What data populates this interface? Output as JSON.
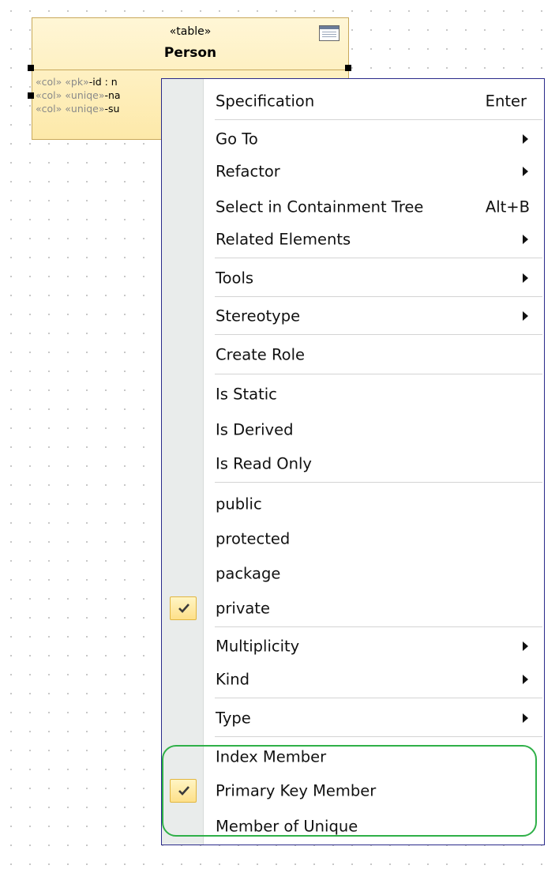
{
  "table": {
    "stereotype": "«table»",
    "name": "Person",
    "rows": [
      {
        "stereo": "«col» «pk»",
        "text": "-id : n"
      },
      {
        "stereo": "«col» «uniqe»",
        "text": "-na"
      },
      {
        "stereo": "«col» «uniqe»",
        "text": "-su"
      }
    ]
  },
  "menu": {
    "items": {
      "specification": {
        "label": "Specification",
        "shortcut": "Enter"
      },
      "go_to": {
        "label": "Go To"
      },
      "refactor": {
        "label": "Refactor"
      },
      "select_tree": {
        "label": "Select in Containment Tree",
        "shortcut": "Alt+B"
      },
      "related": {
        "label": "Related Elements"
      },
      "tools": {
        "label": "Tools"
      },
      "stereotype": {
        "label": "Stereotype"
      },
      "create_role": {
        "label": "Create Role"
      },
      "is_static": {
        "label": "Is Static"
      },
      "is_derived": {
        "label": "Is Derived"
      },
      "is_read_only": {
        "label": "Is Read Only"
      },
      "public": {
        "label": "public"
      },
      "protected": {
        "label": "protected"
      },
      "package": {
        "label": "package"
      },
      "private": {
        "label": "private",
        "checked": true
      },
      "multiplicity": {
        "label": "Multiplicity"
      },
      "kind": {
        "label": "Kind"
      },
      "type": {
        "label": "Type"
      },
      "index_member": {
        "label": "Index Member"
      },
      "primary_key_member": {
        "label": "Primary Key Member",
        "checked": true
      },
      "member_of_unique": {
        "label": "Member of Unique"
      }
    }
  },
  "icons": {
    "table_icon": "table-icon",
    "submenu_arrow": "chevron-right-icon",
    "check": "checkmark-icon"
  },
  "colors": {
    "menu_border": "#2a2a8a",
    "highlight": "#2fb048",
    "element_fill": "#fde9a9"
  }
}
